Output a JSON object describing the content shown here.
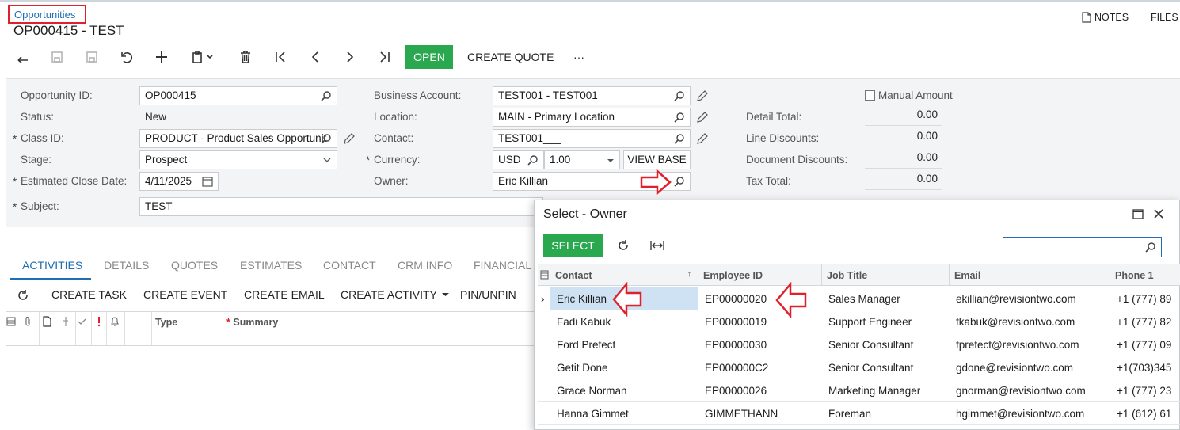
{
  "breadcrumb": "Opportunities",
  "page_title": "OP000415 - TEST",
  "header_links": {
    "notes": "NOTES",
    "files": "FILES"
  },
  "toolbar": {
    "open": "OPEN",
    "create_quote": "CREATE QUOTE",
    "more": "···"
  },
  "form": {
    "opportunity_id_label": "Opportunity ID:",
    "opportunity_id": "OP000415",
    "status_label": "Status:",
    "status": "New",
    "class_id_label": "Class ID:",
    "class_id": "PRODUCT - Product Sales Opportunit",
    "stage_label": "Stage:",
    "stage": "Prospect",
    "close_date_label": "Estimated Close Date:",
    "close_date": "4/11/2025",
    "subject_label": "Subject:",
    "subject": "TEST",
    "business_account_label": "Business Account:",
    "business_account": "TEST001 - TEST001___",
    "location_label": "Location:",
    "location": "MAIN - Primary Location",
    "contact_label": "Contact:",
    "contact": "TEST001___",
    "currency_label": "Currency:",
    "currency": "USD",
    "rate": "1.00",
    "view_base": "VIEW BASE",
    "owner_label": "Owner:",
    "owner": "Eric Killian",
    "manual_amount_label": "Manual Amount",
    "detail_total_label": "Detail Total:",
    "detail_total": "0.00",
    "line_discounts_label": "Line Discounts:",
    "line_discounts": "0.00",
    "document_discounts_label": "Document Discounts:",
    "document_discounts": "0.00",
    "tax_total_label": "Tax Total:",
    "tax_total": "0.00"
  },
  "tabs": [
    "ACTIVITIES",
    "DETAILS",
    "QUOTES",
    "ESTIMATES",
    "CONTACT",
    "CRM INFO",
    "FINANCIAL"
  ],
  "activities_toolbar": {
    "create_task": "CREATE TASK",
    "create_event": "CREATE EVENT",
    "create_email": "CREATE EMAIL",
    "create_activity": "CREATE ACTIVITY",
    "pin_unpin": "PIN/UNPIN"
  },
  "activities_grid": {
    "type_header": "Type",
    "summary_header": "Summary",
    "required_mark": "*"
  },
  "dialog": {
    "title": "Select - Owner",
    "select_button": "SELECT",
    "columns": [
      "Contact",
      "Employee ID",
      "Job Title",
      "Email",
      "Phone 1"
    ],
    "rows": [
      {
        "contact": "Eric Killian",
        "employee_id": "EP00000020",
        "job_title": "Sales Manager",
        "email": "ekillian@revisiontwo.com",
        "phone": "+1 (777) 89"
      },
      {
        "contact": "Fadi Kabuk",
        "employee_id": "EP00000019",
        "job_title": "Support Engineer",
        "email": "fkabuk@revisiontwo.com",
        "phone": "+1 (777) 82"
      },
      {
        "contact": "Ford Prefect",
        "employee_id": "EP00000030",
        "job_title": "Senior Consultant",
        "email": "fprefect@revisiontwo.com",
        "phone": "+1 (777) 09"
      },
      {
        "contact": "Getit Done",
        "employee_id": "EP000000C2",
        "job_title": "Senior Consultant",
        "email": "gdone@revisiontwo.com",
        "phone": "+1(703)345"
      },
      {
        "contact": "Grace Norman",
        "employee_id": "EP00000026",
        "job_title": "Marketing Manager",
        "email": "gnorman@revisiontwo.com",
        "phone": "+1 (777) 23"
      },
      {
        "contact": "Hanna Gimmet",
        "employee_id": "GIMMETHANN",
        "job_title": "Foreman",
        "email": "hgimmet@revisiontwo.com",
        "phone": "+1 (612) 61"
      }
    ]
  },
  "colors": {
    "accent": "#1f6fb2",
    "green": "#2aa84f",
    "highlight": "#e0202a",
    "selected_row": "#cfe2f3"
  }
}
